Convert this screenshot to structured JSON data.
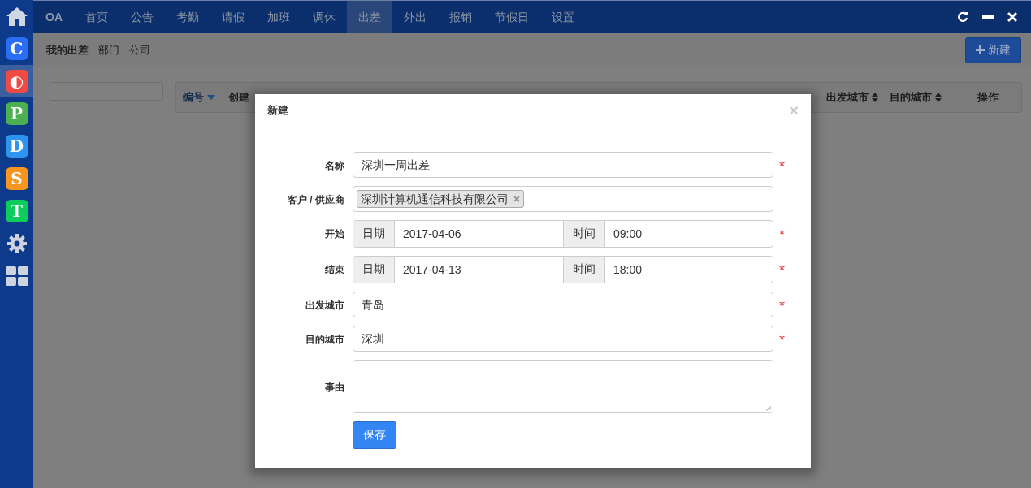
{
  "sidebar": {
    "items": [
      {
        "kind": "home",
        "selected": false
      },
      {
        "kind": "app",
        "glyph": "C",
        "color": "#2a6ef5",
        "selected": false
      },
      {
        "kind": "app",
        "glyph": "◐",
        "color": "#f04a44",
        "selected": true
      },
      {
        "kind": "app",
        "glyph": "P",
        "color": "#4cb050",
        "selected": false
      },
      {
        "kind": "app",
        "glyph": "D",
        "color": "#2d95f0",
        "selected": false
      },
      {
        "kind": "app",
        "glyph": "S",
        "color": "#f7951e",
        "selected": false
      },
      {
        "kind": "app",
        "glyph": "T",
        "color": "#0ccc5c",
        "selected": false
      },
      {
        "kind": "gear",
        "selected": false
      },
      {
        "kind": "grid",
        "selected": false
      }
    ]
  },
  "nav": {
    "brand": "OA",
    "items": [
      {
        "label": "首页",
        "selected": false
      },
      {
        "label": "公告",
        "selected": false
      },
      {
        "label": "考勤",
        "selected": false
      },
      {
        "label": "请假",
        "selected": false
      },
      {
        "label": "加班",
        "selected": false
      },
      {
        "label": "调休",
        "selected": false
      },
      {
        "label": "出差",
        "selected": true
      },
      {
        "label": "外出",
        "selected": false
      },
      {
        "label": "报销",
        "selected": false
      },
      {
        "label": "节假日",
        "selected": false
      },
      {
        "label": "设置",
        "selected": false
      }
    ]
  },
  "subnav": {
    "items": [
      {
        "label": "我的出差",
        "selected": true
      },
      {
        "label": "部门",
        "selected": false
      },
      {
        "label": "公司",
        "selected": false
      }
    ],
    "new_button": "新建"
  },
  "table": {
    "columns": [
      {
        "label": "编号",
        "kind": "sorted"
      },
      {
        "label": "创建",
        "kind": "plain"
      },
      {
        "label": "出发城市",
        "kind": "sortable"
      },
      {
        "label": "目的城市",
        "kind": "sortable"
      },
      {
        "label": "操作",
        "kind": "plain"
      }
    ]
  },
  "modal": {
    "title": "新建",
    "close": "×",
    "fields": [
      {
        "kind": "text",
        "label": "名称",
        "value": "深圳一周出差",
        "required_mark": "*"
      },
      {
        "kind": "tags",
        "label": "客户 / 供应商",
        "tags": [
          "深圳计算机通信科技有限公司"
        ]
      },
      {
        "kind": "datetime",
        "label": "开始",
        "date_label": "日期",
        "date": "2017-04-06",
        "time_label": "时间",
        "time": "09:00",
        "required_mark": "*"
      },
      {
        "kind": "datetime",
        "label": "结束",
        "date_label": "日期",
        "date": "2017-04-13",
        "time_label": "时间",
        "time": "18:00",
        "required_mark": "*"
      },
      {
        "kind": "text",
        "label": "出发城市",
        "value": "青岛",
        "required_mark": "*"
      },
      {
        "kind": "text",
        "label": "目的城市",
        "value": "深圳",
        "required_mark": "*"
      },
      {
        "kind": "textarea",
        "label": "事由"
      }
    ],
    "save_button": "保存"
  }
}
